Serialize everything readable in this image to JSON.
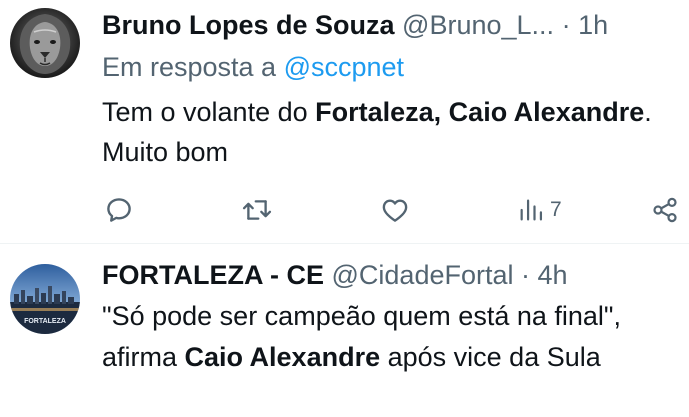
{
  "tweets": [
    {
      "author": {
        "name": "Bruno Lopes de Souza",
        "handle": "@Bruno_L...",
        "avatar": "lion-avatar"
      },
      "separator": "·",
      "time": "1h",
      "reply_prefix": "Em resposta a",
      "reply_to": "@sccpnet",
      "text": {
        "part1": "Tem o volante do ",
        "bold1": "Fortaleza, Caio Alexandre",
        "part2": ". Muito bom"
      },
      "actions": {
        "reply_icon": "reply-icon",
        "retweet_icon": "retweet-icon",
        "like_icon": "like-icon",
        "views_icon": "views-icon",
        "views_count": "7",
        "share_icon": "share-icon"
      }
    },
    {
      "author": {
        "name": "FORTALEZA - CE",
        "handle": "@CidadeFortal",
        "avatar": "fortaleza-city-avatar",
        "avatar_label": "FORTALEZA"
      },
      "separator": "·",
      "time": "4h",
      "text": {
        "part1": "\"Só pode ser campeão quem está na final\", afirma ",
        "bold1": "Caio Alexandre",
        "part2": " após vice da Sula"
      }
    }
  ],
  "colors": {
    "text": "#0f1419",
    "secondary": "#536471",
    "link": "#1d9bf0",
    "divider": "#eff3f4"
  }
}
